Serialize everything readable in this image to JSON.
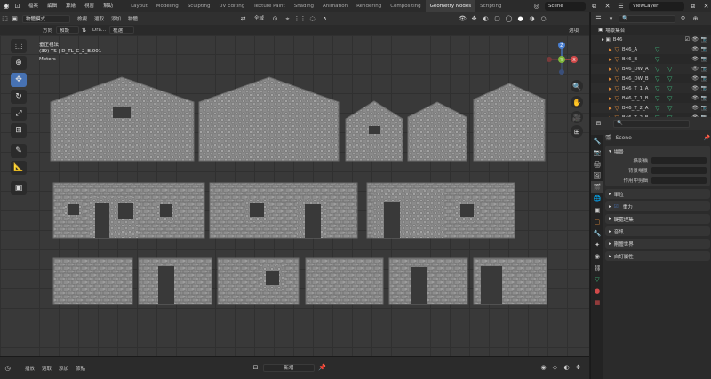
{
  "top_menu": [
    "檔案",
    "編輯",
    "算繪",
    "視窗",
    "幫助"
  ],
  "workspace_tabs": [
    {
      "label": "Layout",
      "active": false
    },
    {
      "label": "Modeling",
      "active": false
    },
    {
      "label": "Sculpting",
      "active": false
    },
    {
      "label": "UV Editing",
      "active": false
    },
    {
      "label": "Texture Paint",
      "active": false
    },
    {
      "label": "Shading",
      "active": false
    },
    {
      "label": "Animation",
      "active": false
    },
    {
      "label": "Rendering",
      "active": false
    },
    {
      "label": "Compositing",
      "active": false
    },
    {
      "label": "Geometry Nodes",
      "active": true
    },
    {
      "label": "Scripting",
      "active": false
    }
  ],
  "scene_name": "Scene",
  "view_layer": "ViewLayer",
  "viewport_header": {
    "mode": "物體模式",
    "menus": [
      "檢視",
      "選取",
      "添加",
      "物體"
    ],
    "transform_orientation": "全域",
    "options": "選項"
  },
  "viewport_header2": {
    "direction_label": "方向",
    "direction_value": "預設",
    "drag_label": "Dra...",
    "drag_value": "框選"
  },
  "viewport_overlay": {
    "view_name": "垂正視法",
    "object_info": "(39) TS | D_TL_C_2_B.001",
    "units": "Meters"
  },
  "gizmo": {
    "x": "X",
    "y": "Y",
    "z": "Z"
  },
  "outliner": {
    "root": "場景集合",
    "collection": "B46",
    "items": [
      {
        "name": "B46_A",
        "mods": 1
      },
      {
        "name": "B46_B",
        "mods": 1
      },
      {
        "name": "B46_DW_A",
        "mods": 2
      },
      {
        "name": "B46_DW_B",
        "mods": 2
      },
      {
        "name": "B46_T_1_A",
        "mods": 2
      },
      {
        "name": "B46_T_1_B",
        "mods": 2
      },
      {
        "name": "B46_T_2_A",
        "mods": 2
      },
      {
        "name": "B46_T_2_B",
        "mods": 2
      }
    ]
  },
  "properties": {
    "scene_label": "Scene",
    "panel_scene": "場景",
    "camera_label": "攝影機",
    "background_scene_label": "背景場景",
    "active_clip_label": "作用中剪輯",
    "collapsed_panels": [
      "單位",
      "重力",
      "鍵處理集",
      "音訊",
      "剛體世界",
      "自訂屬性"
    ]
  },
  "timeline": {
    "menus": [
      "播放",
      "選取",
      "添加",
      "節點"
    ],
    "new_button": "新增"
  },
  "colors": {
    "accent": "#4772b3",
    "active_tab": "#3d3d3d",
    "mesh_orange": "#e08b3a",
    "modifier_green": "#3fbf7f",
    "wall_stone": "#8c8c8c"
  }
}
